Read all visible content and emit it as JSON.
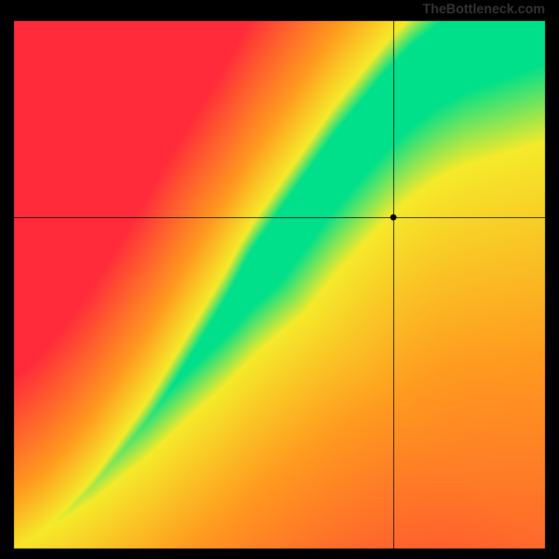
{
  "watermark": "TheBottleneck.com",
  "chart_data": {
    "type": "heatmap",
    "title": "",
    "xlabel": "",
    "ylabel": "",
    "x_range": [
      0,
      1
    ],
    "y_range": [
      0,
      1
    ],
    "crosshair": {
      "x": 0.715,
      "y": 0.628
    },
    "marker": {
      "x": 0.715,
      "y": 0.628
    },
    "optimal_curve": [
      [
        0.0,
        0.0
      ],
      [
        0.05,
        0.03
      ],
      [
        0.1,
        0.07
      ],
      [
        0.15,
        0.12
      ],
      [
        0.2,
        0.18
      ],
      [
        0.25,
        0.24
      ],
      [
        0.3,
        0.31
      ],
      [
        0.35,
        0.38
      ],
      [
        0.4,
        0.45
      ],
      [
        0.45,
        0.53
      ],
      [
        0.5,
        0.6
      ],
      [
        0.55,
        0.67
      ],
      [
        0.6,
        0.74
      ],
      [
        0.65,
        0.8
      ],
      [
        0.7,
        0.86
      ],
      [
        0.75,
        0.91
      ],
      [
        0.8,
        0.95
      ],
      [
        0.85,
        0.98
      ],
      [
        0.9,
        1.0
      ]
    ],
    "color_stops": {
      "optimal": "#00e08a",
      "near": "#f5ea2a",
      "mid": "#ff9a1f",
      "far": "#ff2a3a"
    },
    "annotations": []
  }
}
